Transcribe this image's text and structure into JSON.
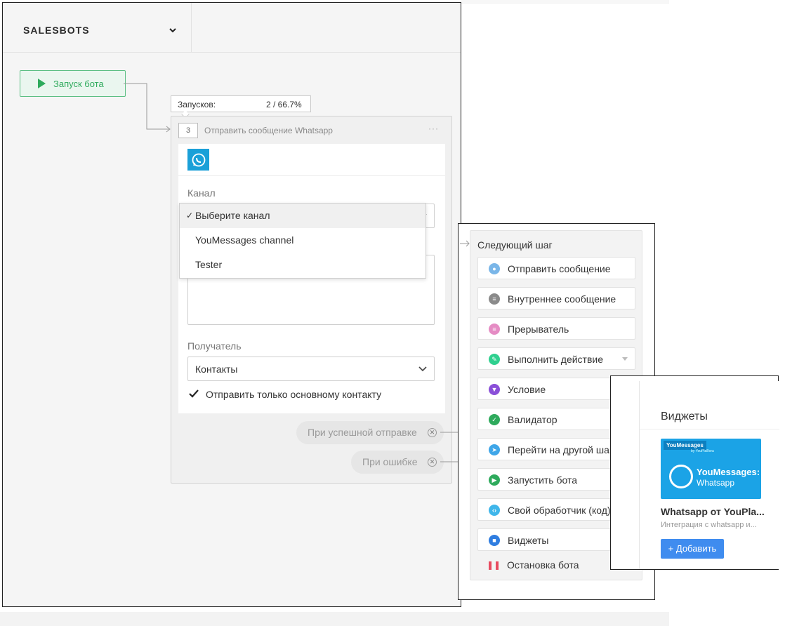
{
  "header": {
    "title": "SALESBOTS"
  },
  "flow": {
    "start_label": "Запуск бота"
  },
  "stats": {
    "label": "Запусков:",
    "value": "2 / 66.7%"
  },
  "step": {
    "number": "3",
    "title": "Отправить сообщение Whatsapp",
    "more": "···",
    "channel_label": "Канал",
    "channel_options": [
      "Выберите канал",
      "YouMessages channel",
      "Tester"
    ],
    "recipient_label": "Получатель",
    "recipient_value": "Контакты",
    "checkbox_label": "Отправить только основному контакту",
    "checkbox_checked": true,
    "on_success": "При успешной отправке",
    "on_error": "При ошибке"
  },
  "next_step": {
    "title": "Следующий шаг",
    "actions": [
      {
        "label": "Отправить сообщение",
        "icon": "robot-icon",
        "color": "#7ab6e8"
      },
      {
        "label": "Внутреннее сообщение",
        "icon": "chat-icon",
        "color": "#8a8a8a"
      },
      {
        "label": "Прерыватель",
        "icon": "interrupt-icon",
        "color": "#e58cc4"
      },
      {
        "label": "Выполнить действие",
        "icon": "pencil-icon",
        "color": "#2fd08f"
      },
      {
        "label": "Условие",
        "icon": "filter-icon",
        "color": "#8a4fd8"
      },
      {
        "label": "Валидатор",
        "icon": "check-icon",
        "color": "#2eaa5c"
      },
      {
        "label": "Перейти на другой шаг",
        "icon": "goto-icon",
        "color": "#3fa6e8"
      },
      {
        "label": "Запустить бота",
        "icon": "play-icon",
        "color": "#2eaa5c"
      },
      {
        "label": "Свой обработчик (код)",
        "icon": "code-icon",
        "color": "#3fb6ea"
      },
      {
        "label": "Виджеты",
        "icon": "widget-icon",
        "color": "#2f7de0"
      },
      {
        "label": "Остановка бота",
        "icon": "pause-icon",
        "color": "#e84a5f"
      }
    ]
  },
  "widgets": {
    "title": "Виджеты",
    "promo_logo": "YouMessages",
    "promo_by": "by YouPlaBora",
    "promo_line1": "YouMessages:",
    "promo_line2": "Whatsapp",
    "name": "Whatsapp от YouPla...",
    "desc": "Интеграция с whatsapp и...",
    "add_label": "+ Добавить"
  }
}
